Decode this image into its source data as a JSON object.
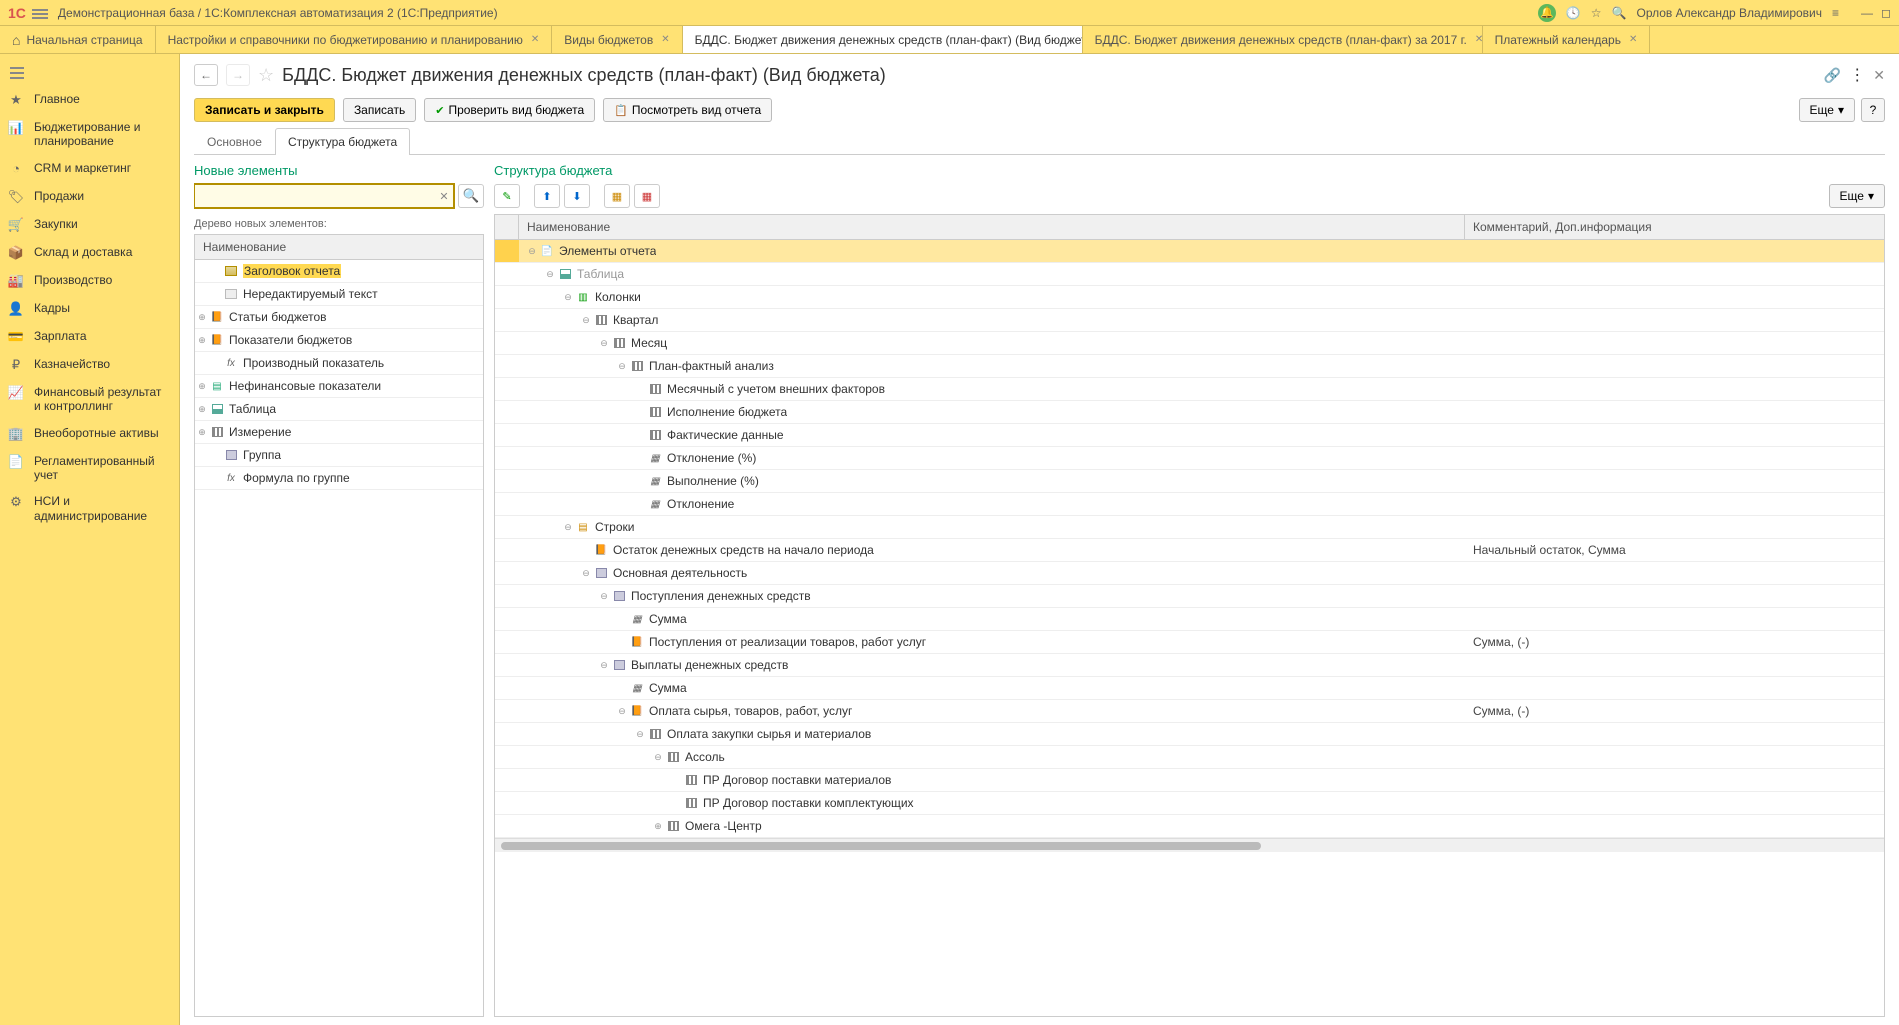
{
  "title_bar": {
    "logo": "1C",
    "title": "Демонстрационная база / 1С:Комплексная автоматизация 2  (1С:Предприятие)",
    "user": "Орлов Александр Владимирович"
  },
  "tabs": {
    "home": "Начальная страница",
    "t1": "Настройки и справочники по бюджетированию и планированию",
    "t2": "Виды  бюджетов",
    "t3": "БДДС. Бюджет движения денежных средств (план-факт) (Вид бюджета)",
    "t4": "БДДС. Бюджет движения денежных средств (план-факт)  за 2017 г.",
    "t5": "Платежный календарь"
  },
  "sidebar": {
    "main": "Главное",
    "budget": "Бюджетирование и планирование",
    "crm": "CRM и маркетинг",
    "sales": "Продажи",
    "purchase": "Закупки",
    "warehouse": "Склад и доставка",
    "production": "Производство",
    "hr": "Кадры",
    "salary": "Зарплата",
    "treasury": "Казначейство",
    "fin": "Финансовый результат и контроллинг",
    "assets": "Внеоборотные активы",
    "reg": "Регламентированный учет",
    "nsi": "НСИ и администрирование"
  },
  "page": {
    "title": "БДДС. Бюджет движения денежных средств (план-факт) (Вид бюджета)"
  },
  "toolbar": {
    "save_close": "Записать и закрыть",
    "save": "Записать",
    "check": "Проверить вид бюджета",
    "view_report": "Посмотреть вид отчета",
    "more": "Еще",
    "help": "?"
  },
  "subtabs": {
    "t1": "Основное",
    "t2": "Структура бюджета"
  },
  "left_panel": {
    "title": "Новые элементы",
    "tree_label": "Дерево новых элементов:",
    "col": "Наименование",
    "items": {
      "i0": "Заголовок отчета",
      "i1": "Нередактируемый текст",
      "i2": "Статьи бюджетов",
      "i3": "Показатели бюджетов",
      "i4": "Производный показатель",
      "i5": "Нефинансовые показатели",
      "i6": "Таблица",
      "i7": "Измерение",
      "i8": "Группа",
      "i9": "Формула по группе"
    }
  },
  "right_panel": {
    "title": "Структура бюджета",
    "col1": "Наименование",
    "col2": "Комментарий, Доп.информация",
    "more": "Еще",
    "rows": {
      "r0": {
        "label": "Элементы отчета",
        "comment": ""
      },
      "r1": {
        "label": "Таблица",
        "comment": ""
      },
      "r2": {
        "label": "Колонки",
        "comment": ""
      },
      "r3": {
        "label": "Квартал",
        "comment": ""
      },
      "r4": {
        "label": "Месяц",
        "comment": ""
      },
      "r5": {
        "label": "План-фактный анализ",
        "comment": ""
      },
      "r6": {
        "label": "Месячный с учетом внешних факторов",
        "comment": ""
      },
      "r7": {
        "label": "Исполнение бюджета",
        "comment": ""
      },
      "r8": {
        "label": "Фактические данные",
        "comment": ""
      },
      "r9": {
        "label": "Отклонение (%)",
        "comment": ""
      },
      "r10": {
        "label": "Выполнение (%)",
        "comment": ""
      },
      "r11": {
        "label": "Отклонение",
        "comment": ""
      },
      "r12": {
        "label": "Строки",
        "comment": ""
      },
      "r13": {
        "label": "Остаток денежных средств на начало периода",
        "comment": "Начальный остаток, Сумма"
      },
      "r14": {
        "label": "Основная деятельность",
        "comment": ""
      },
      "r15": {
        "label": "Поступления денежных средств",
        "comment": ""
      },
      "r16": {
        "label": "Сумма",
        "comment": ""
      },
      "r17": {
        "label": "Поступления от реализации товаров, работ услуг",
        "comment": "Сумма, (-)"
      },
      "r18": {
        "label": "Выплаты денежных средств",
        "comment": ""
      },
      "r19": {
        "label": "Сумма",
        "comment": ""
      },
      "r20": {
        "label": "Оплата сырья, товаров, работ, услуг",
        "comment": "Сумма, (-)"
      },
      "r21": {
        "label": "Оплата закупки сырья и материалов",
        "comment": ""
      },
      "r22": {
        "label": "Ассоль",
        "comment": ""
      },
      "r23": {
        "label": "ПР Договор поставки материалов",
        "comment": ""
      },
      "r24": {
        "label": "ПР Договор поставки комплектующих",
        "comment": ""
      },
      "r25": {
        "label": "Омега -Центр",
        "comment": ""
      }
    }
  }
}
